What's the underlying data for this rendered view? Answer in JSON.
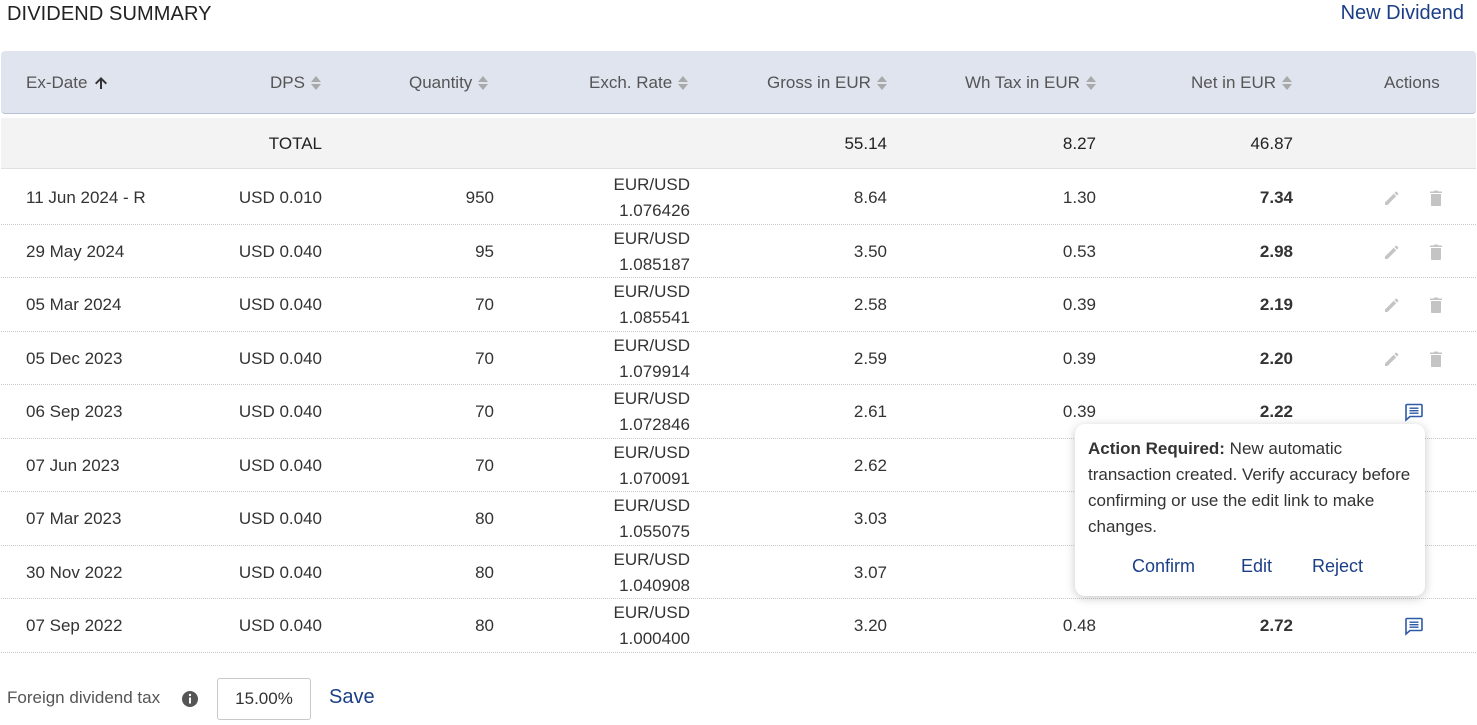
{
  "header": {
    "title": "DIVIDEND SUMMARY",
    "new_dividend": "New Dividend"
  },
  "columns": {
    "ex_date": "Ex-Date",
    "dps": "DPS",
    "quantity": "Quantity",
    "exch_rate": "Exch. Rate",
    "gross": "Gross in EUR",
    "wh_tax": "Wh Tax in EUR",
    "net": "Net in EUR",
    "actions": "Actions"
  },
  "total": {
    "label": "TOTAL",
    "gross": "55.14",
    "wh_tax": "8.27",
    "net": "46.87"
  },
  "rows": [
    {
      "ex_date": "11 Jun 2024 - R",
      "dps": "USD 0.010",
      "quantity": "950",
      "pair": "EUR/USD",
      "rate": "1.076426",
      "gross": "8.64",
      "wh_tax": "1.30",
      "net": "7.34",
      "actions": "edit-delete"
    },
    {
      "ex_date": "29 May 2024",
      "dps": "USD 0.040",
      "quantity": "95",
      "pair": "EUR/USD",
      "rate": "1.085187",
      "gross": "3.50",
      "wh_tax": "0.53",
      "net": "2.98",
      "actions": "edit-delete"
    },
    {
      "ex_date": "05 Mar 2024",
      "dps": "USD 0.040",
      "quantity": "70",
      "pair": "EUR/USD",
      "rate": "1.085541",
      "gross": "2.58",
      "wh_tax": "0.39",
      "net": "2.19",
      "actions": "edit-delete"
    },
    {
      "ex_date": "05 Dec 2023",
      "dps": "USD 0.040",
      "quantity": "70",
      "pair": "EUR/USD",
      "rate": "1.079914",
      "gross": "2.59",
      "wh_tax": "0.39",
      "net": "2.20",
      "actions": "edit-delete"
    },
    {
      "ex_date": "06 Sep 2023",
      "dps": "USD 0.040",
      "quantity": "70",
      "pair": "EUR/USD",
      "rate": "1.072846",
      "gross": "2.61",
      "wh_tax": "0.39",
      "net": "2.22",
      "actions": "message"
    },
    {
      "ex_date": "07 Jun 2023",
      "dps": "USD 0.040",
      "quantity": "70",
      "pair": "EUR/USD",
      "rate": "1.070091",
      "gross": "2.62",
      "wh_tax": "0.",
      "net": "",
      "actions": ""
    },
    {
      "ex_date": "07 Mar 2023",
      "dps": "USD 0.040",
      "quantity": "80",
      "pair": "EUR/USD",
      "rate": "1.055075",
      "gross": "3.03",
      "wh_tax": "0.",
      "net": "",
      "actions": ""
    },
    {
      "ex_date": "30 Nov 2022",
      "dps": "USD 0.040",
      "quantity": "80",
      "pair": "EUR/USD",
      "rate": "1.040908",
      "gross": "3.07",
      "wh_tax": "0.",
      "net": "",
      "actions": ""
    },
    {
      "ex_date": "07 Sep 2022",
      "dps": "USD 0.040",
      "quantity": "80",
      "pair": "EUR/USD",
      "rate": "1.000400",
      "gross": "3.20",
      "wh_tax": "0.48",
      "net": "2.72",
      "actions": "message"
    }
  ],
  "popup": {
    "title": "Action Required:",
    "message": " New automatic transaction created. Verify accuracy before confirming or use the edit link to make changes.",
    "confirm": "Confirm",
    "edit": "Edit",
    "reject": "Reject"
  },
  "footer": {
    "label": "Foreign dividend tax",
    "tax_value": "15.00%",
    "save": "Save"
  },
  "colors": {
    "link": "#1b3f86",
    "header_bg": "#dfe4ef",
    "total_bg": "#f3f3f3",
    "icon_gray": "#c4c4c4",
    "message_icon": "#2e5aa8"
  },
  "icons": {
    "sort_asc": "arrow-up-icon",
    "sort_both": "sort-icon",
    "edit": "pencil-icon",
    "delete": "trash-icon",
    "message": "message-icon",
    "info": "info-icon"
  }
}
